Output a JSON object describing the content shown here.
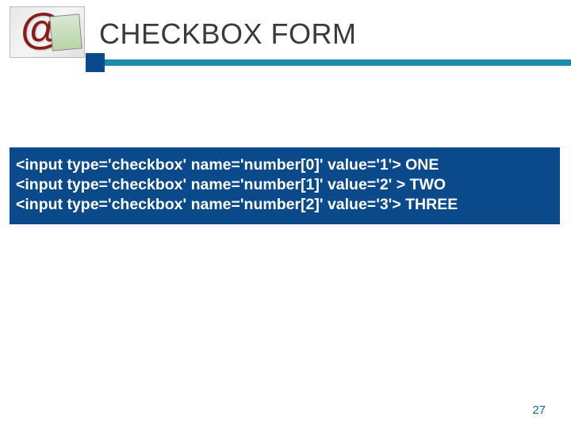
{
  "header": {
    "title": "CHECKBOX FORM"
  },
  "code": {
    "line1": "<input type='checkbox' name='number[0]' value='1'> ONE",
    "line2": "<input type='checkbox' name='number[1]' value='2' > TWO",
    "line3": "<input type='checkbox' name='number[2]' value='3'> THREE"
  },
  "footer": {
    "page_number": "27"
  },
  "logo": {
    "symbol": "@"
  }
}
